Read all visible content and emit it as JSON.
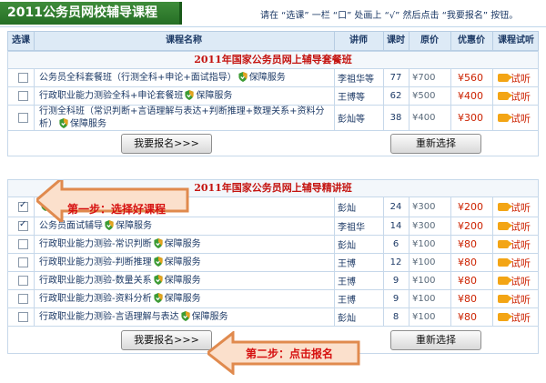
{
  "header": {
    "title": "2011公务员网校辅导课程",
    "instruction": "请在 “选课” 一栏 “口” 处画上 “√” 然后点击 “我要报名” 按钮。"
  },
  "columns": [
    "选课",
    "课程名称",
    "讲师",
    "课时",
    "原价",
    "优惠价",
    "课程试听"
  ],
  "guarantee_label": "保障服务",
  "trial_label": "试听",
  "sections": [
    {
      "title": "2011年国家公务员网上辅导套餐班",
      "rows": [
        {
          "checked": false,
          "course": "公务员全科套餐班（行测全科+申论+面试指导）",
          "teacher": "李祖华等",
          "hours": "77",
          "orig": "¥700",
          "disc": "¥560"
        },
        {
          "checked": false,
          "course": "行政职业能力测验全科+申论套餐班",
          "teacher": "王博等",
          "hours": "62",
          "orig": "¥500",
          "disc": "¥400"
        },
        {
          "checked": false,
          "course": "行测全科班（常识判断+言语理解与表达+判断推理+数理关系+资料分析）",
          "teacher": "彭灿等",
          "hours": "38",
          "orig": "¥400",
          "disc": "¥300"
        }
      ],
      "register_label": "我要报名>>>",
      "reset_label": "重新选择"
    },
    {
      "title": "2011年国家公务员网上辅导精讲班",
      "rows": [
        {
          "checked": true,
          "course": "",
          "teacher": "彭灿",
          "hours": "24",
          "orig": "¥300",
          "disc": "¥200"
        },
        {
          "checked": true,
          "course": "公务员面试辅导",
          "teacher": "李祖华",
          "hours": "14",
          "orig": "¥300",
          "disc": "¥200"
        },
        {
          "checked": false,
          "course": "行政职业能力测验-常识判断",
          "teacher": "彭灿",
          "hours": "6",
          "orig": "¥100",
          "disc": "¥80"
        },
        {
          "checked": false,
          "course": "行政职业能力测验-判断推理",
          "teacher": "王博",
          "hours": "12",
          "orig": "¥100",
          "disc": "¥80"
        },
        {
          "checked": false,
          "course": "行政职业能力测验-数量关系",
          "teacher": "王博",
          "hours": "9",
          "orig": "¥100",
          "disc": "¥80"
        },
        {
          "checked": false,
          "course": "行政职业能力测验-资料分析",
          "teacher": "王博",
          "hours": "9",
          "orig": "¥100",
          "disc": "¥80"
        },
        {
          "checked": false,
          "course": "行政职业能力测验-言语理解与表达",
          "teacher": "彭灿",
          "hours": "8",
          "orig": "¥100",
          "disc": "¥80"
        }
      ],
      "register_label": "我要报名>>>",
      "reset_label": "重新选择"
    }
  ],
  "callouts": {
    "step1": "第一步：选择好课程",
    "step2": "第二步：点击报名"
  },
  "colors": {
    "title_bg": "#2f7d2f",
    "section_title": "#c4130f",
    "price": "#cc2200",
    "callout": "#d61010",
    "callout_fill": "#fbe0cc"
  }
}
